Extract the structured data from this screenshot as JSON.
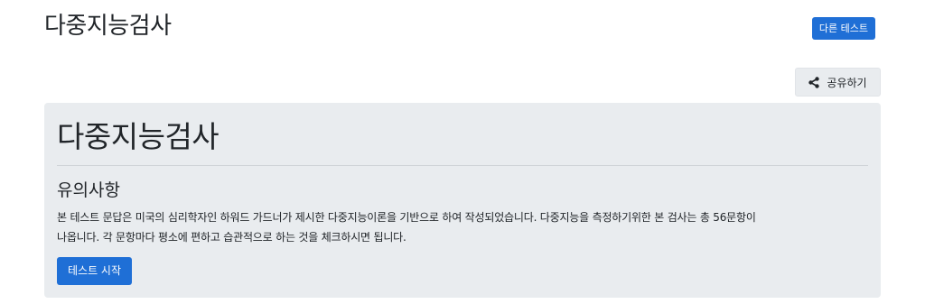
{
  "header": {
    "site_title": "다중지능검사",
    "other_test_label": "다른 테스트"
  },
  "share": {
    "label": "공유하기",
    "icon": "share-icon"
  },
  "card": {
    "title": "다중지능검사",
    "notice_heading": "유의사항",
    "notice_line1": "본 테스트 문답은 미국의 심리학자인 하워드 가드너가 제시한 다중지능이론을 기반으로 하여 작성되었습니다. 다중지능을 측정하기위한 본 검사는 총 56문항이",
    "notice_line2": "나옵니다. 각 문항마다 평소에 편하고 습관적으로 하는 것을 체크하시면 됩니다.",
    "start_label": "테스트 시작"
  },
  "colors": {
    "primary": "#1f6fd6",
    "card_bg": "#e9ecef",
    "text": "#212529"
  }
}
